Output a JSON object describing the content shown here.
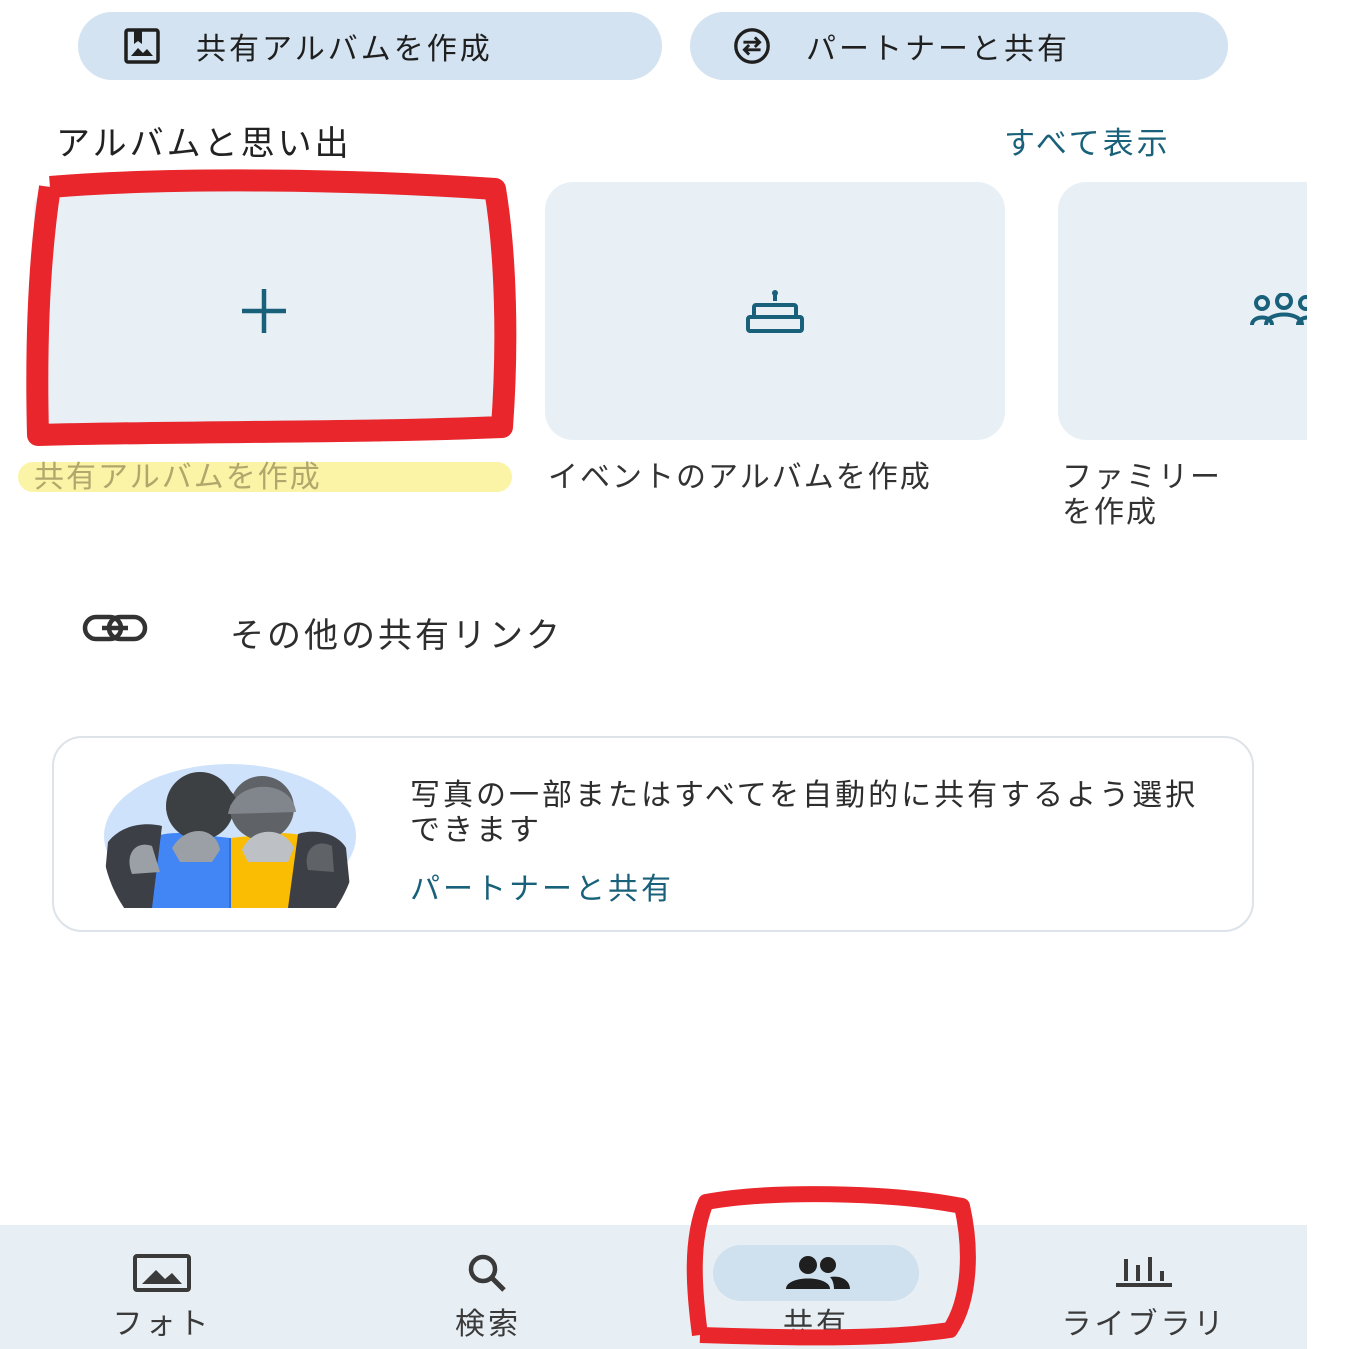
{
  "top_chips": {
    "create_shared_album": "共有アルバムを作成",
    "share_with_partner": "パートナーと共有"
  },
  "albums_section": {
    "title": "アルバムと思い出",
    "see_all": "すべて表示",
    "cards": [
      {
        "label": "共有アルバムを作成",
        "icon": "plus-icon"
      },
      {
        "label": "イベントのアルバムを作成",
        "icon": "cake-icon"
      },
      {
        "label": "ファミリー\nを作成",
        "icon": "family-icon"
      }
    ]
  },
  "other_links": {
    "label": "その他の共有リンク",
    "icon": "link-icon"
  },
  "promo": {
    "text": "写真の一部またはすべてを自動的に共有するよう選択できます",
    "link": "パートナーと共有"
  },
  "bottom_nav": {
    "items": [
      {
        "label": "フォト",
        "icon": "photo-icon"
      },
      {
        "label": "検索",
        "icon": "search-icon"
      },
      {
        "label": "共有",
        "icon": "people-icon",
        "selected": true
      },
      {
        "label": "ライブラリ",
        "icon": "library-icon"
      }
    ]
  },
  "colors": {
    "accent": "#19617a",
    "chip_bg": "#d3e3f1",
    "card_bg": "#e8f0f6",
    "annotation_red": "#e8262b",
    "highlight_yellow": "#fbf39c"
  }
}
